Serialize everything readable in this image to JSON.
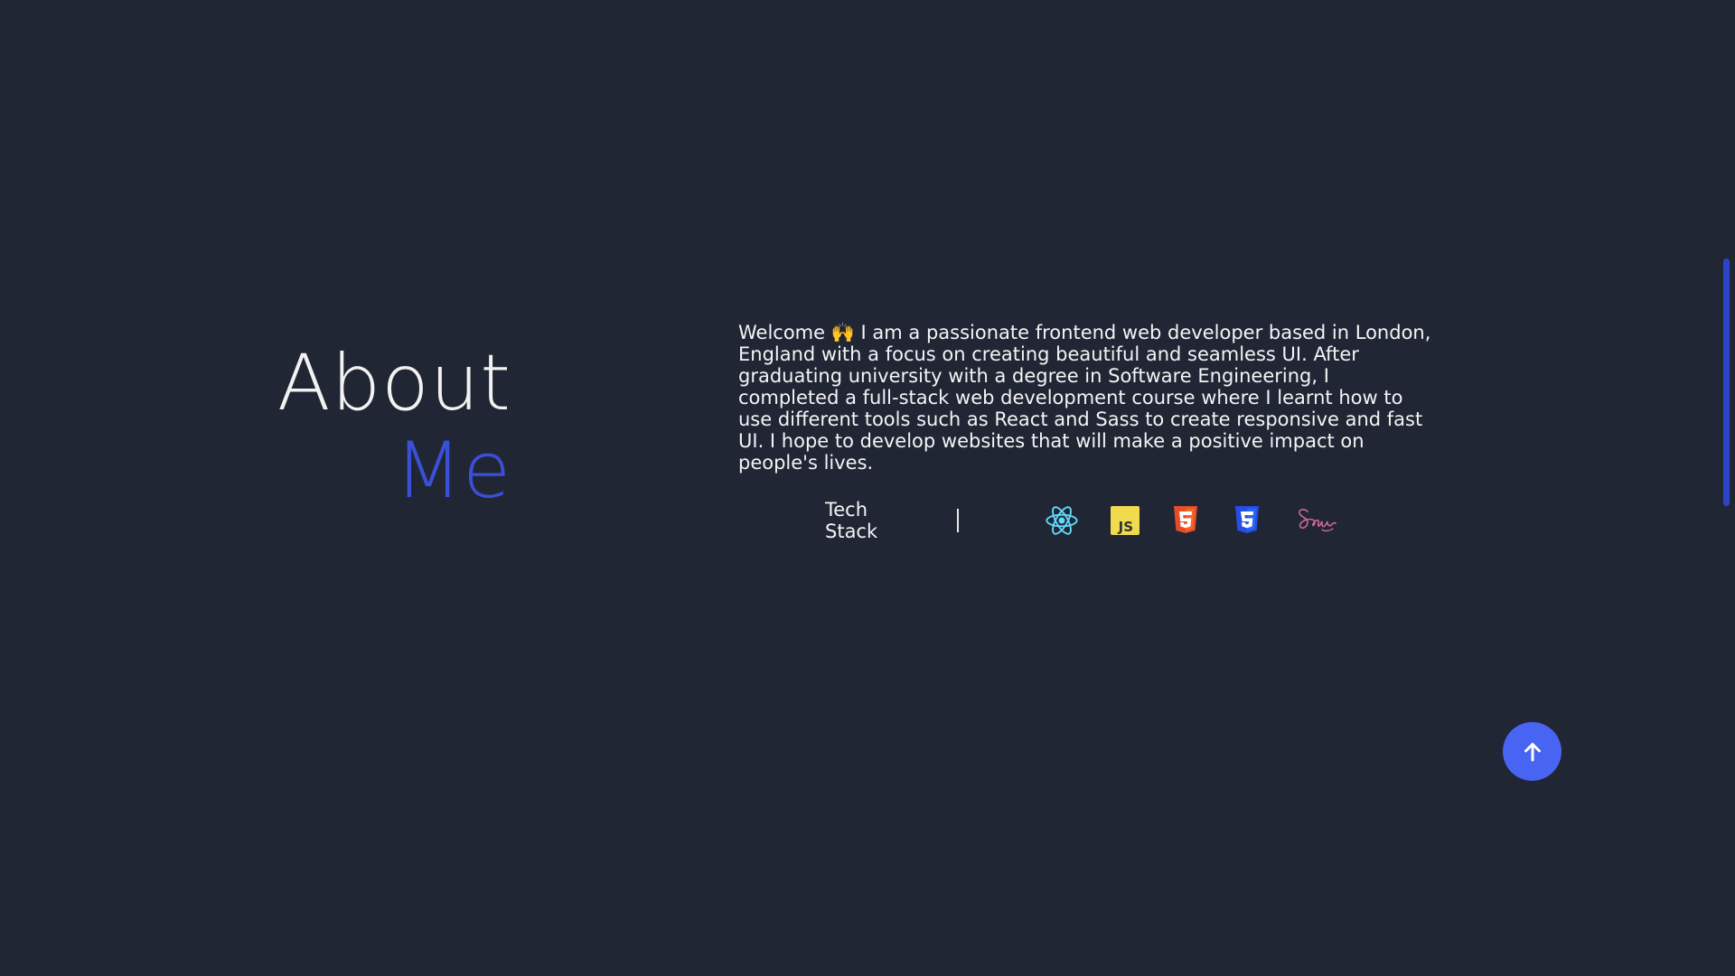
{
  "about": {
    "heading_line1": "About",
    "heading_line2": "Me",
    "bio": "Welcome 🙌 I am a passionate frontend web developer based in London, England with a focus on creating beautiful and seamless UI. After graduating university with a degree in Software Engineering, I completed a full-stack web development course where I learnt how to use different tools such as React and Sass to create responsive and fast UI. I hope to develop websites that will make a positive impact on people's lives."
  },
  "tech_stack": {
    "label": "Tech Stack",
    "icons": [
      "react-icon",
      "javascript-icon",
      "html5-icon",
      "css3-icon",
      "sass-icon"
    ],
    "js_text": "JS"
  },
  "colors": {
    "background": "#212634",
    "accent": "#3a50d6",
    "button": "#4764f2",
    "react": "#61dafb",
    "javascript": "#f0db4f",
    "html5": "#e44d26",
    "css3": "#264de4",
    "sass": "#cd6799"
  },
  "back_to_top": {
    "icon": "arrow-up-icon"
  }
}
